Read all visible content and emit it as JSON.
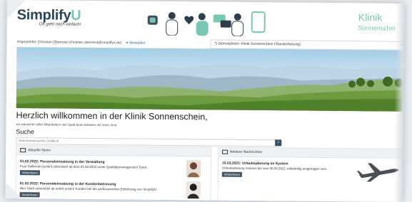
{
  "header": {
    "logo_main": "Simplify",
    "logo_accent": "U",
    "slogan": "Oft geht noch einfach!",
    "clinic_title": "Klinik",
    "clinic_subtitle": "Sonnenschei"
  },
  "userbar": {
    "user_text": "Angemeldet: Christian Oberreist (christian.oberreist@simplifyu.de)",
    "logout_label": "Abmelden",
    "role_selected": "*) Demosystem: Klinik Sonnenschein (Standortleitung)"
  },
  "main": {
    "welcome": "Herzlich willkommen in der Klinik Sonnenschein,",
    "subtext": "wir wünschen allen Mitarbeitern viel Spaß beim Arbeiten mit mehr Sinn.",
    "search_title": "Suche",
    "search_placeholder": "Dokumentensuche (Volltext)"
  },
  "news_panel": {
    "title": "Aktuelle News",
    "items": [
      {
        "title": "01.02.2022: Personaleinsatzung in der Verwaltung",
        "text": "Frau Gallenski (seidel) unterstützt ab dem 01.02.2022 unser Qualitätsmanagement Team.",
        "button": "Weiterlesen"
      },
      {
        "title": "01.02.2022: Personaleinsatzung in der Kundenbetreuung",
        "text": "Herr Stork unterstützt ab sofort unsere Kunden bei der professionellen Einführung von SimplifyU.",
        "button": "Weiterlesen"
      }
    ]
  },
  "info_panel": {
    "title": "Weitere Nachrichten",
    "items": [
      {
        "title": "10.03.2021: Urlaubsplanung im System",
        "text": "Urlaubsplanung müssen bis zum 30.04.2021 vollständig eingetragen sein.",
        "button": "Weiterlesen"
      }
    ]
  },
  "colors": {
    "brand_dark": "#27465a",
    "brand_accent": "#77c7b4",
    "link": "#2463a9",
    "button": "#405466"
  }
}
